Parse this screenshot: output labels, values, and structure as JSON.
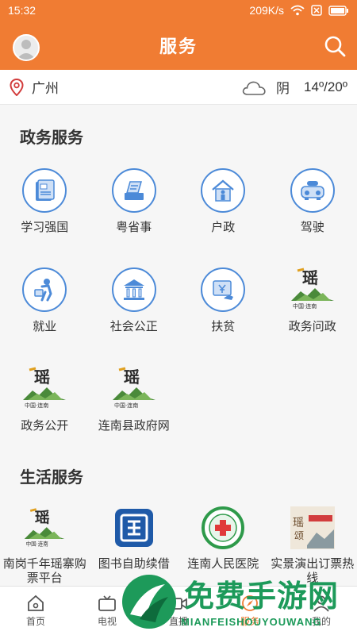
{
  "status_bar": {
    "time": "15:32",
    "network_speed": "209K/s",
    "icons": [
      "wifi-icon",
      "sim-icon",
      "battery-icon"
    ]
  },
  "header": {
    "title": "服务",
    "avatar_icon": "user-avatar-icon",
    "search_icon": "search-icon"
  },
  "weather": {
    "city": "广州",
    "condition": "阴",
    "temperature": "14º/20º"
  },
  "gov_section": {
    "title": "政务服务",
    "items": [
      {
        "label": "学习强国",
        "icon": "book-flag-icon"
      },
      {
        "label": "粤省事",
        "icon": "document-stack-icon"
      },
      {
        "label": "户政",
        "icon": "household-icon"
      },
      {
        "label": "驾驶",
        "icon": "car-icon"
      },
      {
        "label": "就业",
        "icon": "worker-icon"
      },
      {
        "label": "社会公正",
        "icon": "courthouse-icon"
      },
      {
        "label": "扶贫",
        "icon": "aid-icon"
      },
      {
        "label": "政务问政",
        "icon": "liannan-logo-icon"
      },
      {
        "label": "政务公开",
        "icon": "liannan-logo-icon"
      },
      {
        "label": "连南县政府网",
        "icon": "liannan-logo-icon"
      }
    ]
  },
  "life_section": {
    "title": "生活服务",
    "items": [
      {
        "label": "南岗千年瑶寨购票平台",
        "icon": "liannan-logo-icon"
      },
      {
        "label": "图书自助续借",
        "icon": "library-logo-icon"
      },
      {
        "label": "连南人民医院",
        "icon": "hospital-logo-icon"
      },
      {
        "label": "实景演出订票热线",
        "icon": "performance-poster-icon"
      }
    ]
  },
  "tabbar": {
    "items": [
      {
        "label": "首页",
        "icon": "home-icon"
      },
      {
        "label": "电视",
        "icon": "tv-icon"
      },
      {
        "label": "直播",
        "icon": "live-icon"
      },
      {
        "label": "服务",
        "icon": "service-icon",
        "active": true
      },
      {
        "label": "我的",
        "icon": "profile-icon"
      }
    ]
  },
  "watermark": {
    "text_cn": "免费手游网",
    "text_en": "MIANFEISHOUYOUWANG"
  },
  "colors": {
    "brand_orange": "#f07c33",
    "icon_blue": "#4c8ad8",
    "watermark_green": "#1d9a5a"
  }
}
